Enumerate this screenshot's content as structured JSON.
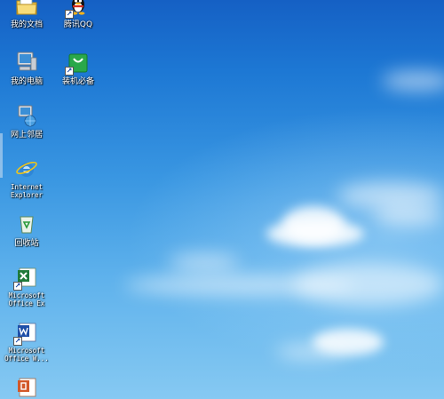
{
  "desktop": {
    "icons": [
      {
        "label": "我的文档",
        "icon": "folder-docs-icon"
      },
      {
        "label": "腾讯QQ",
        "icon": "qq-penguin-icon"
      },
      {
        "label": "我的电脑",
        "icon": "computer-icon"
      },
      {
        "label": "装机必备",
        "icon": "shopping-bag-icon"
      },
      {
        "label": "网上邻居",
        "icon": "network-icon"
      },
      {
        "label": "Internet\nExplorer",
        "icon": "internet-explorer-icon"
      },
      {
        "label": "回收站",
        "icon": "recycle-bin-icon"
      },
      {
        "label": "Microsoft\nOffice Ex",
        "icon": "excel-icon"
      },
      {
        "label": "Microsoft\nOffice W...",
        "icon": "word-icon"
      },
      {
        "label": "",
        "icon": "powerpoint-icon"
      }
    ]
  },
  "colors": {
    "sky_top": "#1560c4",
    "sky_bottom": "#86c9f2",
    "label_text": "#ffffff"
  }
}
